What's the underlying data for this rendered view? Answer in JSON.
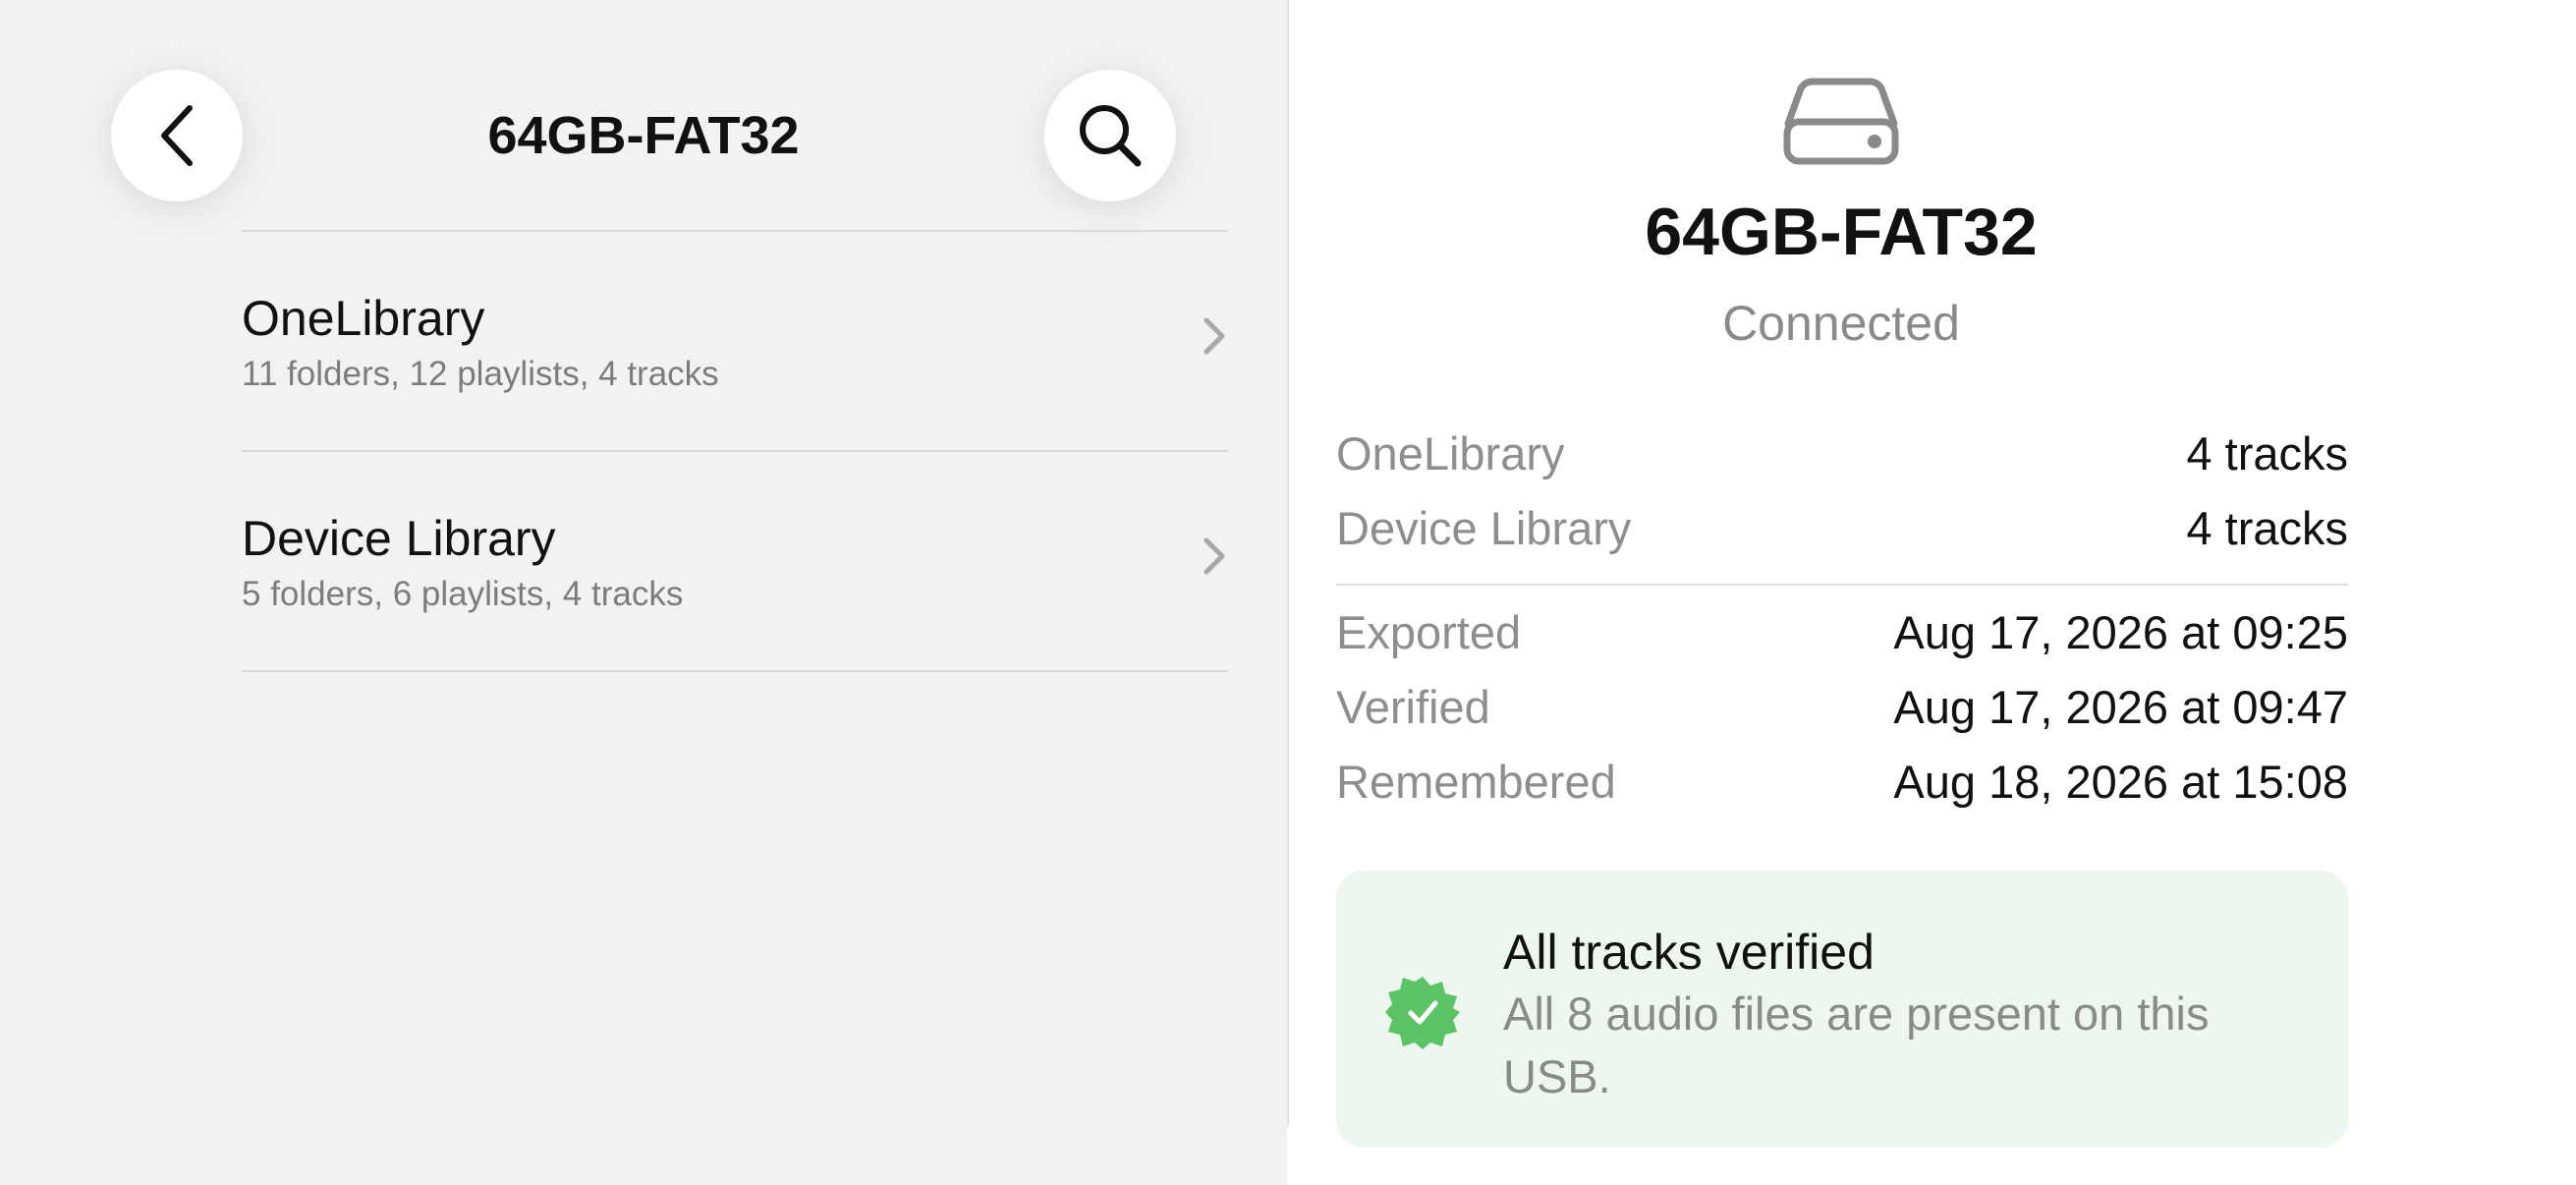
{
  "nav": {
    "title": "64GB-FAT32"
  },
  "list": {
    "items": [
      {
        "title": "OneLibrary",
        "subtitle": "11 folders, 12 playlists, 4 tracks"
      },
      {
        "title": "Device Library",
        "subtitle": "5 folders, 6 playlists, 4 tracks"
      }
    ]
  },
  "detail": {
    "icon": "external-drive-icon",
    "name": "64GB-FAT32",
    "status": "Connected",
    "libraries": [
      {
        "label": "OneLibrary",
        "value": "4 tracks"
      },
      {
        "label": "Device Library",
        "value": "4 tracks"
      }
    ],
    "history": [
      {
        "label": "Exported",
        "value": "Aug 17, 2026 at 09:25"
      },
      {
        "label": "Verified",
        "value": "Aug 17, 2026 at 09:47"
      },
      {
        "label": "Remembered",
        "value": "Aug 18, 2026 at 15:08"
      }
    ],
    "verification": {
      "icon": "checkmark-seal-icon",
      "title": "All tracks verified",
      "description": "All 8 audio files are present on this USB.",
      "accent_color": "#5cc466",
      "background_color": "#edf7ee"
    }
  }
}
